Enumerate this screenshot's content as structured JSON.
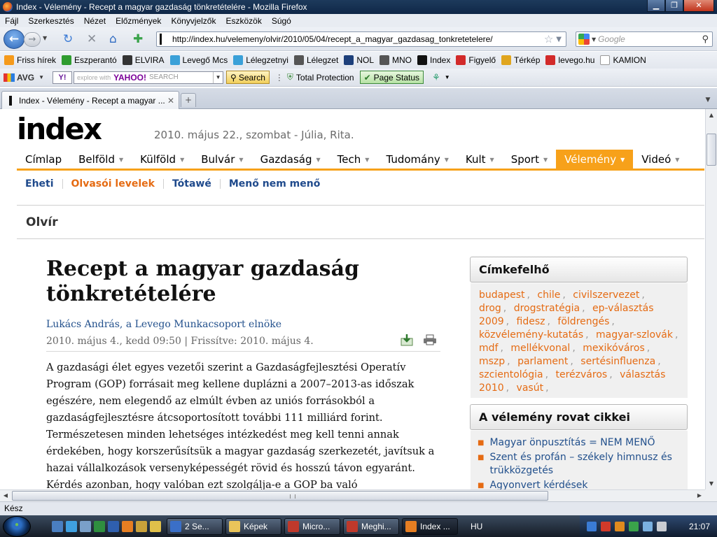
{
  "window": {
    "title": "Index - Vélemény - Recept a magyar gazdaság tönkretételére - Mozilla Firefox"
  },
  "menu": [
    "Fájl",
    "Szerkesztés",
    "Nézet",
    "Előzmények",
    "Könyvjelzők",
    "Eszközök",
    "Súgó"
  ],
  "navbar": {
    "url": "http://index.hu/velemeny/olvir/2010/05/04/recept_a_magyar_gazdasag_tonkretetelere/",
    "search_placeholder": "Google"
  },
  "bookmarks": [
    {
      "label": "Friss hírek",
      "icon": "rss-icon",
      "color": "#f59a1b"
    },
    {
      "label": "Eszperantó",
      "icon": "esperanto-icon",
      "color": "#2f9c2f"
    },
    {
      "label": "ELVIRA",
      "icon": "elvira-icon",
      "color": "#333333"
    },
    {
      "label": "Levegő Mcs",
      "icon": "levego-icon",
      "color": "#3aa0d8"
    },
    {
      "label": "Lélegzetnyi",
      "icon": "levego-icon",
      "color": "#3aa0d8"
    },
    {
      "label": "Lélegzet",
      "icon": "lelegzet-icon",
      "color": "#555555"
    },
    {
      "label": "NOL",
      "icon": "nol-icon",
      "color": "#1d3f7a"
    },
    {
      "label": "MNO",
      "icon": "mno-icon",
      "color": "#555555"
    },
    {
      "label": "Index",
      "icon": "index-icon",
      "color": "#111111"
    },
    {
      "label": "Figyelő",
      "icon": "figyelo-icon",
      "color": "#d22a2a"
    },
    {
      "label": "Térkép",
      "icon": "map-icon",
      "color": "#e0a51e"
    },
    {
      "label": "levego.hu",
      "icon": "gmail-icon",
      "color": "#d22a2a"
    },
    {
      "label": "KAMION",
      "icon": "page-icon",
      "color": "#ffffff"
    }
  ],
  "toolbar2": {
    "avg": "AVG",
    "yahoo_btn": "Y!",
    "yahoo_hint": "explore with",
    "yahoo_brand": "YAHOO!",
    "yahoo_search": "SEARCH",
    "search_btn": "Search",
    "total_protection": "Total Protection",
    "page_status": "Page Status"
  },
  "tab": {
    "title": "Index - Vélemény - Recept a magyar ..."
  },
  "site": {
    "logo": "index",
    "dateline": "2010. május 22., szombat - Júlia, Rita.",
    "nav": [
      {
        "label": "Címlap",
        "arrow": false
      },
      {
        "label": "Belföld",
        "arrow": true
      },
      {
        "label": "Külföld",
        "arrow": true
      },
      {
        "label": "Bulvár",
        "arrow": true
      },
      {
        "label": "Gazdaság",
        "arrow": true
      },
      {
        "label": "Tech",
        "arrow": true
      },
      {
        "label": "Tudomány",
        "arrow": true
      },
      {
        "label": "Kult",
        "arrow": true
      },
      {
        "label": "Sport",
        "arrow": true
      },
      {
        "label": "Vélemény",
        "arrow": true,
        "active": true
      },
      {
        "label": "Videó",
        "arrow": true
      }
    ],
    "subnav": [
      {
        "label": "Eheti",
        "orange": false
      },
      {
        "label": "Olvasói levelek",
        "orange": true
      },
      {
        "label": "Tótawé",
        "orange": false
      },
      {
        "label": "Menő nem menő",
        "orange": false
      }
    ],
    "rubric": "Olvír"
  },
  "article": {
    "title": "Recept a magyar gazdaság tönkretételére",
    "author": "Lukács András, a Levego Munkacsoport elnöke",
    "date": "2010. május 4., kedd 09:50 | Frissítve: 2010. május 4.",
    "lead": "A gazdasági élet egyes vezetői szerint a Gazdaságfejlesztési Operatív Program (GOP) forrásait meg kellene duplázni a 2007–2013-as időszak egészére, nem elegendő az elmúlt évben az uniós forrásokból a gazdaságfejlesztésre átcsoportosított további 111 milliárd forint. Természetesen minden lehetséges intézkedést meg kell tenni annak érdekében, hogy korszerűsítsük a magyar gazdaság szerkezetét, javítsuk a hazai vállalkozások versenyképességét rövid és hosszú távon egyaránt. Kérdés azonban, hogy valóban ezt szolgálja-e a GOP ba való"
  },
  "sidebar": {
    "tags_title": "Címkefelhő",
    "tags": [
      "budapest",
      "chile",
      "civilszervezet",
      "drog",
      "drogstratégia",
      "ep-választás 2009",
      "fidesz",
      "földrengés",
      "közvélemény-kutatás",
      "magyar-szlovák",
      "mdf",
      "mellékvonal",
      "mexikóváros",
      "mszp",
      "parlament",
      "sertésinfluenza",
      "szcientológia",
      "terézváros",
      "választás 2010",
      "vasút"
    ],
    "articles_title": "A vélemény rovat cikkei",
    "articles": [
      "Magyar önpusztítás = NEM MENŐ",
      "Szent és profán – székely himnusz és trükközgetés",
      "Agyonvert kérdések"
    ]
  },
  "status": {
    "text": "Kész"
  },
  "taskbar": {
    "items": [
      {
        "label": "2 Se...",
        "color": "#3a6fc8"
      },
      {
        "label": "Képek",
        "color": "#e9c45a"
      },
      {
        "label": "Micro...",
        "color": "#c0392b"
      },
      {
        "label": "Meghi...",
        "color": "#c0392b"
      },
      {
        "label": "Index ...",
        "color": "#e67e22",
        "active": true
      }
    ],
    "lang": "HU",
    "clock": "21:07"
  }
}
